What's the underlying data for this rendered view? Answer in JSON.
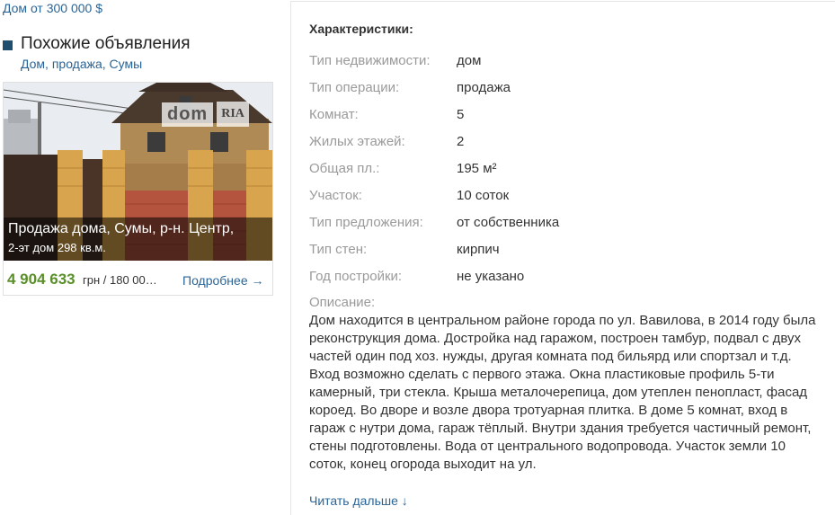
{
  "top_link": "Дом от 300 000 $",
  "similar": {
    "title": "Похожие объявления",
    "subtitle": "Дом, продажа, Сумы"
  },
  "card": {
    "caption_title": "Продажа дома, Сумы, р-н. Центр,",
    "caption_sub": "2-эт дом 298 кв.м.",
    "watermark_dom": "dom",
    "watermark_ria": "RIA",
    "price_main": "4 904 633",
    "price_rest": "грн / 180 00…",
    "more_link": "Подробнее →"
  },
  "characteristics": {
    "title": "Характеристики:",
    "rows": [
      {
        "label": "Тип недвижимости:",
        "value": "дом"
      },
      {
        "label": "Тип операции:",
        "value": "продажа"
      },
      {
        "label": "Комнат:",
        "value": "5"
      },
      {
        "label": "Жилых этажей:",
        "value": "2"
      },
      {
        "label": "Общая пл.:",
        "value": "195 м²"
      },
      {
        "label": "Участок:",
        "value": "10 соток"
      },
      {
        "label": "Тип предложения:",
        "value": "от собственника"
      },
      {
        "label": "Тип стен:",
        "value": "кирпич"
      },
      {
        "label": "Год постройки:",
        "value": "не указано"
      }
    ],
    "description_label": "Описание:",
    "description": "Дом находится в центральном районе города по ул. Вавилова, в 2014 году была реконструкция дома. Достройка над гаражом, построен тамбур, подвал с двух частей один под хоз. нужды, другая комната под бильярд или спортзал и т.д. Вход возможно сделать с первого этажа. Окна пластиковые профиль 5-ти камерный, три стекла. Крыша металочерепица, дом утеплен пенопласт, фасад короед. Во дворе и возле двора тротуарная плитка. В доме 5 комнат, вход в гараж с нутри дома, гараж тёплый. Внутри здания требуется частичный ремонт, стены подготовлены. Вода от центрального водопровода. Участок земли 10 соток, конец огорода выходит на ул.",
    "read_more": "Читать дальше ↓"
  },
  "colors": {
    "link": "#2a6496",
    "price": "#5a8f2a",
    "label": "#9a9a9a"
  }
}
